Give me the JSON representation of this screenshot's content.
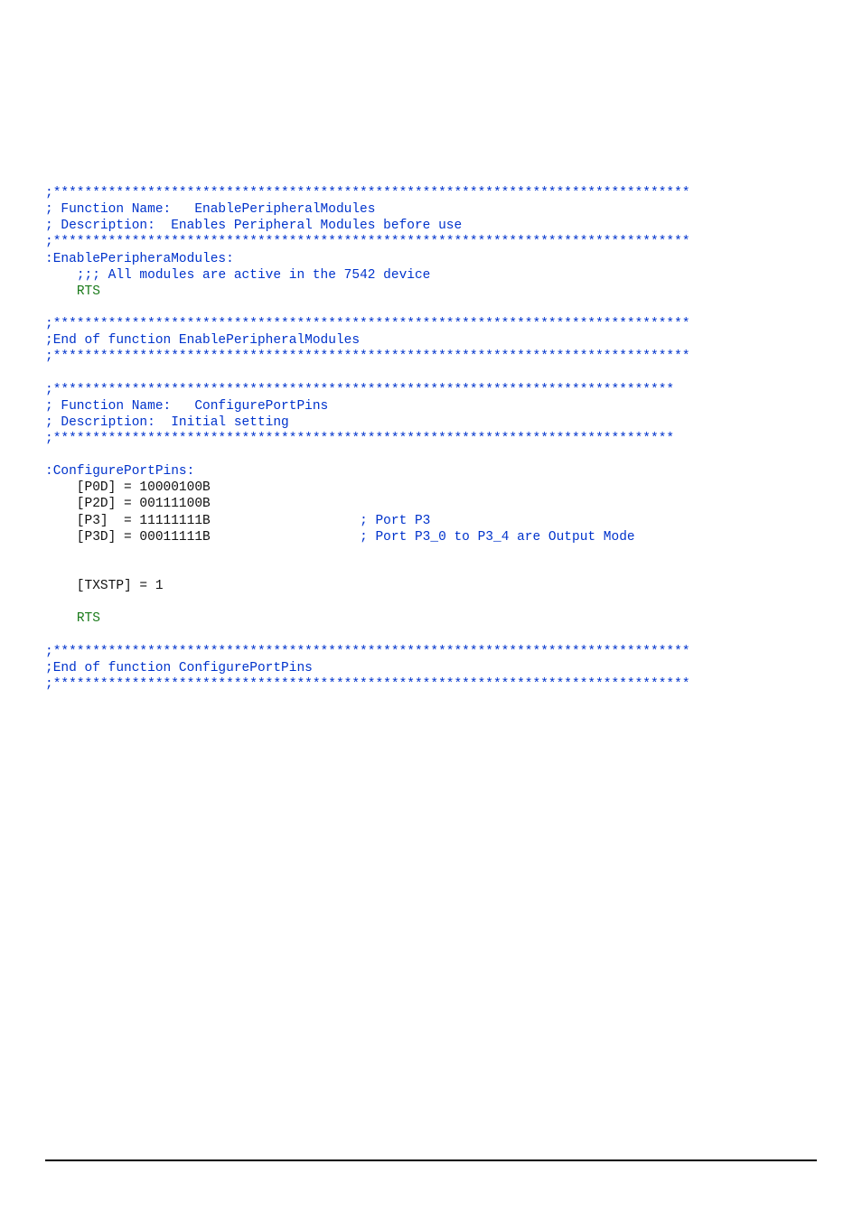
{
  "code": {
    "lines": [
      {
        "segments": [
          {
            "cls": "comment",
            "text": ";*********************************************************************************"
          }
        ]
      },
      {
        "segments": [
          {
            "cls": "comment",
            "text": "; Function Name:   EnablePeripheralModules"
          }
        ]
      },
      {
        "segments": [
          {
            "cls": "comment",
            "text": "; Description:  Enables Peripheral Modules before use"
          }
        ]
      },
      {
        "segments": [
          {
            "cls": "comment",
            "text": ";*********************************************************************************"
          }
        ]
      },
      {
        "segments": [
          {
            "cls": "idline",
            "text": ":EnablePeripheraModules:"
          }
        ]
      },
      {
        "segments": [
          {
            "cls": "plain",
            "text": "    "
          },
          {
            "cls": "comment",
            "text": ";;; All modules are active in the 7542 device"
          }
        ]
      },
      {
        "segments": [
          {
            "cls": "plain",
            "text": "    "
          },
          {
            "cls": "kw",
            "text": "RTS"
          }
        ]
      },
      {
        "segments": [
          {
            "cls": "plain",
            "text": ""
          }
        ]
      },
      {
        "segments": [
          {
            "cls": "comment",
            "text": ";*********************************************************************************"
          }
        ]
      },
      {
        "segments": [
          {
            "cls": "comment",
            "text": ";End of function EnablePeripheralModules"
          }
        ]
      },
      {
        "segments": [
          {
            "cls": "comment",
            "text": ";*********************************************************************************"
          }
        ]
      },
      {
        "segments": [
          {
            "cls": "plain",
            "text": ""
          }
        ]
      },
      {
        "segments": [
          {
            "cls": "comment",
            "text": ";*******************************************************************************"
          }
        ]
      },
      {
        "segments": [
          {
            "cls": "comment",
            "text": "; Function Name:   ConfigurePortPins"
          }
        ]
      },
      {
        "segments": [
          {
            "cls": "comment",
            "text": "; Description:  Initial setting"
          }
        ]
      },
      {
        "segments": [
          {
            "cls": "comment",
            "text": ";*******************************************************************************"
          }
        ]
      },
      {
        "segments": [
          {
            "cls": "plain",
            "text": ""
          }
        ]
      },
      {
        "segments": [
          {
            "cls": "idline",
            "text": ":ConfigurePortPins:"
          }
        ]
      },
      {
        "segments": [
          {
            "cls": "plain",
            "text": "    [P0D] = 10000100B"
          }
        ]
      },
      {
        "segments": [
          {
            "cls": "plain",
            "text": "    [P2D] = 00111100B"
          }
        ]
      },
      {
        "segments": [
          {
            "cls": "plain",
            "text": "    [P3]  = 11111111B                   "
          },
          {
            "cls": "comment",
            "text": "; Port P3"
          }
        ]
      },
      {
        "segments": [
          {
            "cls": "plain",
            "text": "    [P3D] = 00011111B                   "
          },
          {
            "cls": "comment",
            "text": "; Port P3_0 to P3_4 are Output Mode"
          }
        ]
      },
      {
        "segments": [
          {
            "cls": "plain",
            "text": ""
          }
        ]
      },
      {
        "segments": [
          {
            "cls": "plain",
            "text": ""
          }
        ]
      },
      {
        "segments": [
          {
            "cls": "plain",
            "text": "    [TXSTP] = 1"
          }
        ]
      },
      {
        "segments": [
          {
            "cls": "plain",
            "text": ""
          }
        ]
      },
      {
        "segments": [
          {
            "cls": "plain",
            "text": "    "
          },
          {
            "cls": "kw",
            "text": "RTS"
          }
        ]
      },
      {
        "segments": [
          {
            "cls": "plain",
            "text": ""
          }
        ]
      },
      {
        "segments": [
          {
            "cls": "comment",
            "text": ";*********************************************************************************"
          }
        ]
      },
      {
        "segments": [
          {
            "cls": "comment",
            "text": ";End of function ConfigurePortPins"
          }
        ]
      },
      {
        "segments": [
          {
            "cls": "comment",
            "text": ";*********************************************************************************"
          }
        ]
      }
    ]
  }
}
